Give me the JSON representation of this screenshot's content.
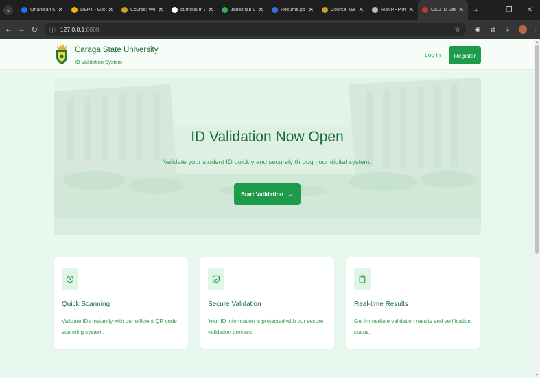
{
  "browser": {
    "tabs": [
      {
        "label": "Orlandian G",
        "icon": "facebook-icon",
        "color": "#1877f2"
      },
      {
        "label": "DEPT - Goog",
        "icon": "google-drive-icon",
        "color": "#f4b400"
      },
      {
        "label": "Course: Web",
        "icon": "csu-course-icon",
        "color": "#caa22e"
      },
      {
        "label": "curriculum vi",
        "icon": "google-icon",
        "color": "#ffffff"
      },
      {
        "label": "Jabez Ian Ch",
        "icon": "green-circle-icon",
        "color": "#2bb24c"
      },
      {
        "label": "Resume.pdf",
        "icon": "pdf-icon",
        "color": "#3b6fd8"
      },
      {
        "label": "Course: Web",
        "icon": "csu-course-icon",
        "color": "#caa22e"
      },
      {
        "label": "Run PHP in V",
        "icon": "globe-icon",
        "color": "#bbbbbb"
      },
      {
        "label": "CSU ID Valid",
        "icon": "csu-logo-icon",
        "color": "#c0392b",
        "active": true
      }
    ],
    "new_tab": "+",
    "url_host": "127.0.0.1",
    "url_port": ":8000"
  },
  "header": {
    "title": "Caraga State University",
    "subtitle": "ID Validation System",
    "login_label": "Log in",
    "register_label": "Register"
  },
  "hero": {
    "title": "ID Validation Now Open",
    "subtitle": "Validate your student ID quickly and securely through our digital system.",
    "button_label": "Start Validation"
  },
  "features": [
    {
      "icon": "clock-icon",
      "title": "Quick Scanning",
      "description": "Validate IDs instantly with our efficient QR code scanning system."
    },
    {
      "icon": "shield-check-icon",
      "title": "Secure Validation",
      "description": "Your ID information is protected with our secure validation process."
    },
    {
      "icon": "clipboard-icon",
      "title": "Real-time Results",
      "description": "Get immediate validation results and verification status."
    }
  ],
  "colors": {
    "primary": "#1d9a4a",
    "page_bg": "#e9f8ee",
    "heading": "#17693a"
  }
}
